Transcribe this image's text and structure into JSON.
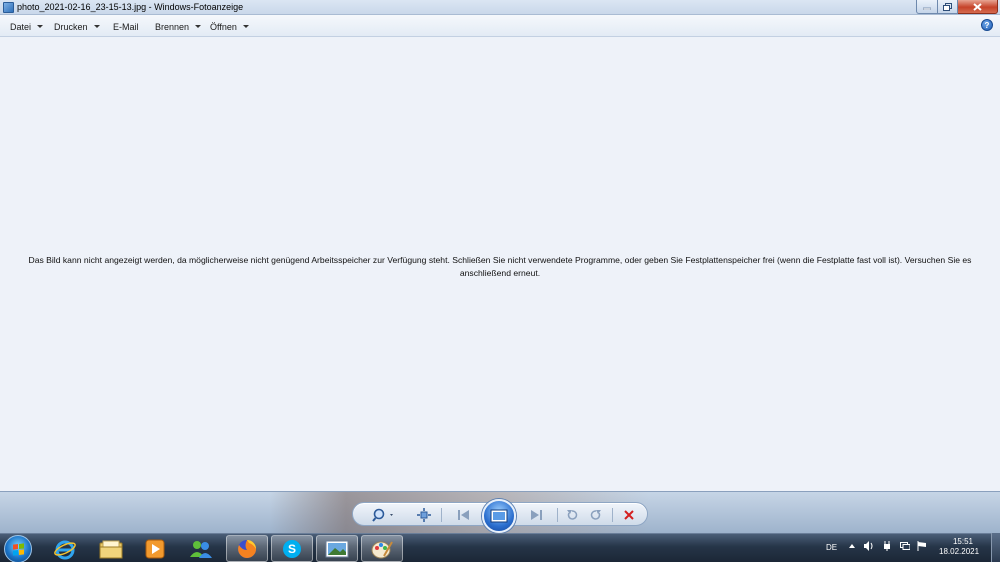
{
  "window": {
    "title": "photo_2021-02-16_23-15-13.jpg - Windows-Fotoanzeige"
  },
  "menu": {
    "items": [
      {
        "label": "Datei",
        "has_dropdown": true
      },
      {
        "label": "Drucken",
        "has_dropdown": true
      },
      {
        "label": "E-Mail",
        "has_dropdown": false
      },
      {
        "label": "Brennen",
        "has_dropdown": true
      },
      {
        "label": "Öffnen",
        "has_dropdown": true
      }
    ],
    "help_glyph": "?"
  },
  "content": {
    "error_line1": "Das Bild kann nicht angezeigt werden, da möglicherweise nicht genügend Arbeitsspeicher zur Verfügung steht. Schließen Sie nicht verwendete Programme, oder geben Sie Festplattenspeicher frei (wenn die Festplatte fast voll ist). Versuchen Sie es",
    "error_line2": "anschließend erneut."
  },
  "viewer_controls": [
    "zoom-icon",
    "fit-window-icon",
    "previous-icon",
    "slideshow-icon",
    "next-icon",
    "rotate-left-icon",
    "rotate-right-icon",
    "delete-icon"
  ],
  "taskbar": {
    "apps": [
      "internet-explorer-icon",
      "file-explorer-icon",
      "media-player-icon",
      "windows-live-messenger-icon",
      "firefox-icon",
      "skype-icon",
      "photo-viewer-icon",
      "paint-icon"
    ],
    "tray": {
      "language": "DE",
      "time": "15:51",
      "date": "18.02.2021"
    }
  },
  "colors": {
    "accent_blue": "#2b6fcf",
    "delete_red": "#d42020",
    "content_bg": "#eef2f9"
  }
}
